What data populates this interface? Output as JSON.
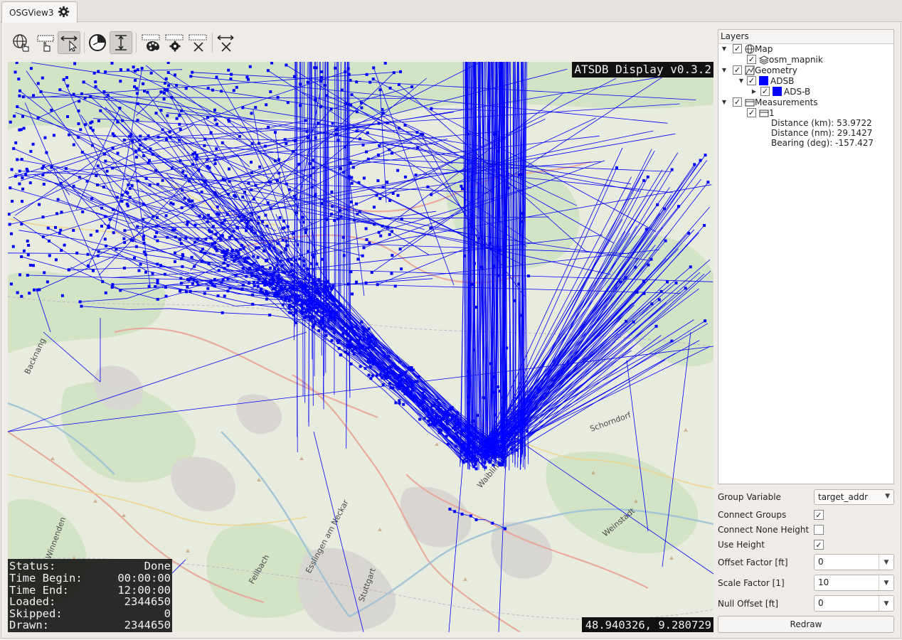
{
  "tab": {
    "title": "OSGView3",
    "icon": "gear-icon"
  },
  "toolbar": {
    "tools": [
      {
        "name": "navigate-tool",
        "icon": "globe-hand-icon",
        "active": false
      },
      {
        "name": "select-tool",
        "icon": "select-hand-icon",
        "active": false
      },
      {
        "name": "measure-tool",
        "icon": "measure-cursor-icon",
        "active": true
      },
      {
        "name": "time-filter-tool",
        "icon": "clock-icon",
        "active": false
      },
      {
        "name": "height-tool",
        "icon": "height-bar-icon",
        "active": true
      },
      {
        "name": "style-tool",
        "icon": "palette-icon",
        "active": false
      },
      {
        "name": "settings-tool",
        "icon": "gear-icon",
        "active": false
      },
      {
        "name": "clear-selection-tool",
        "icon": "close-icon",
        "active": false
      },
      {
        "name": "clear-measurement-tool",
        "icon": "measure-clear-icon",
        "active": false
      }
    ]
  },
  "map": {
    "overlay_title": "ATSDB Display v0.3.2",
    "coordinates": "48.940326, 9.280729",
    "track_color": "#0000ff",
    "labels": [
      "Stuttgart",
      "Esslingen am Neckar",
      "Waiblingen",
      "Winnenden",
      "Backnang",
      "Schorndorf",
      "Fellbach",
      "Weinstadt"
    ],
    "status": [
      {
        "key": "Status:",
        "value": "Done"
      },
      {
        "key": "Time Begin:",
        "value": "00:00:00"
      },
      {
        "key": "Time End:",
        "value": "12:00:00"
      },
      {
        "key": "Loaded:",
        "value": "2344650"
      },
      {
        "key": "Skipped:",
        "value": "0"
      },
      {
        "key": "Drawn:",
        "value": "2344650"
      }
    ]
  },
  "layers": {
    "header": "Layers",
    "tree": {
      "map": {
        "label": "Map",
        "checked": true,
        "icon": "globe-icon"
      },
      "osm": {
        "label": "osm_mapnik",
        "checked": true,
        "icon": "layers-icon"
      },
      "geometry": {
        "label": "Geometry",
        "checked": true,
        "icon": "geometry-icon"
      },
      "adsb": {
        "label": "ADSB",
        "checked": true,
        "color": "#0000ff"
      },
      "adsb_b": {
        "label": "ADS-B",
        "checked": true,
        "color": "#0000ff"
      },
      "measurements": {
        "label": "Measurements",
        "checked": true,
        "icon": "measure-icon"
      },
      "measurement_1": {
        "label": "1",
        "checked": true,
        "icon": "measure-icon"
      }
    },
    "measurement_details": {
      "distance_km": "Distance (km): 53.9722",
      "distance_nm": "Distance (nm): 29.1427",
      "bearing": "Bearing (deg): -157.427"
    }
  },
  "settings": {
    "group_variable": {
      "label": "Group Variable",
      "value": "target_addr"
    },
    "connect_groups": {
      "label": "Connect Groups",
      "checked": true
    },
    "connect_none_height": {
      "label": "Connect None Height",
      "checked": false
    },
    "use_height": {
      "label": "Use Height",
      "checked": true
    },
    "offset_factor": {
      "label": "Offset Factor [ft]",
      "value": "0"
    },
    "scale_factor": {
      "label": "Scale Factor [1]",
      "value": "10"
    },
    "null_offset": {
      "label": "Null Offset [ft]",
      "value": "0"
    },
    "redraw_label": "Redraw"
  }
}
